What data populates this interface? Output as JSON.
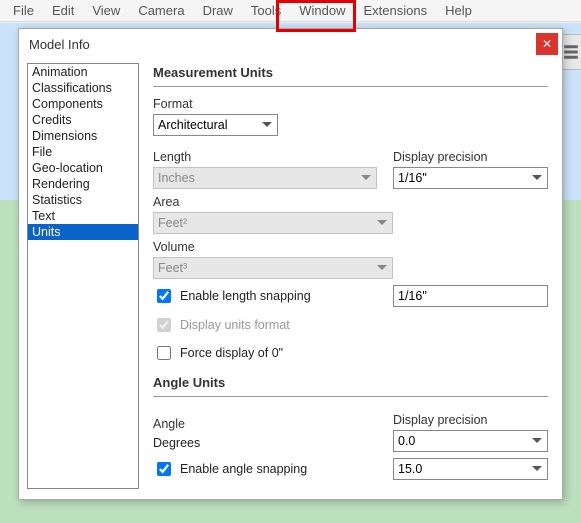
{
  "menubar": {
    "items": [
      "File",
      "Edit",
      "View",
      "Camera",
      "Draw",
      "Tools",
      "Window",
      "Extensions",
      "Help"
    ]
  },
  "dialog": {
    "title": "Model Info",
    "close_glyph": "✕",
    "categories": [
      "Animation",
      "Classifications",
      "Components",
      "Credits",
      "Dimensions",
      "File",
      "Geo-location",
      "Rendering",
      "Statistics",
      "Text",
      "Units"
    ],
    "selected_category": "Units"
  },
  "units": {
    "section_measurement": "Measurement Units",
    "format_label": "Format",
    "format_value": "Architectural",
    "length_label": "Length",
    "length_value": "Inches",
    "precision_label": "Display precision",
    "length_precision": "1/16\"",
    "area_label": "Area",
    "area_value": "Feet²",
    "volume_label": "Volume",
    "volume_value": "Feet³",
    "enable_length_snapping_label": "Enable length snapping",
    "enable_length_snapping_checked": true,
    "length_snap_value": "1/16\"",
    "display_units_format_label": "Display units format",
    "display_units_format_checked": true,
    "force_zero_label": "Force display of 0\"",
    "force_zero_checked": false,
    "section_angle": "Angle Units",
    "angle_label": "Angle",
    "angle_value": "Degrees",
    "angle_precision": "0.0",
    "enable_angle_snapping_label": "Enable angle snapping",
    "enable_angle_snapping_checked": true,
    "angle_snap_value": "15.0"
  }
}
